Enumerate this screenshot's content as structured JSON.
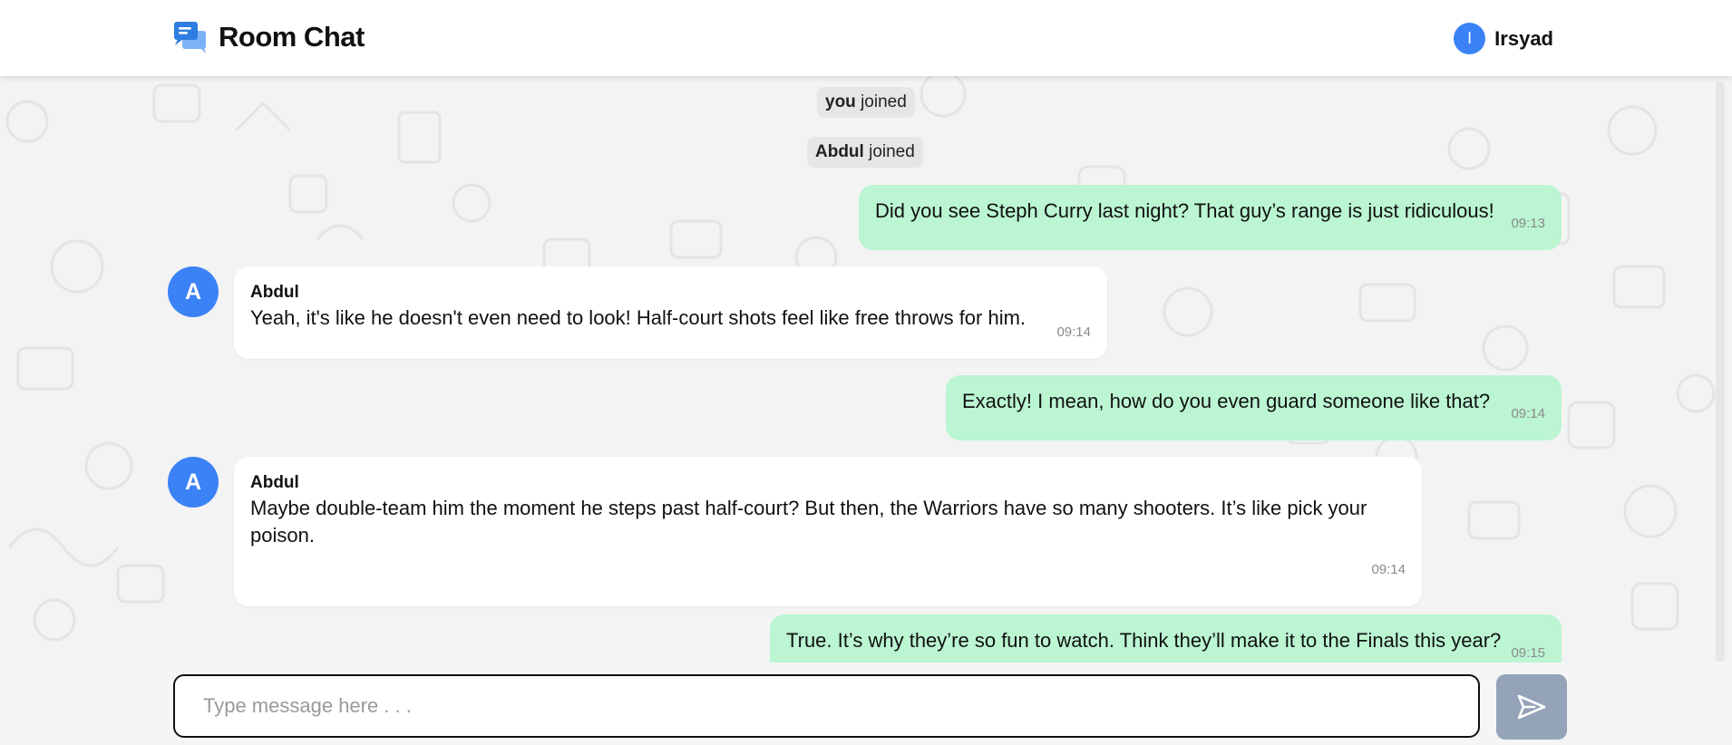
{
  "header": {
    "app_title": "Room Chat",
    "app_icon": "chat-bubbles-icon",
    "user": {
      "initial": "I",
      "name": "Irsyad"
    }
  },
  "system_messages": [
    {
      "name": "you",
      "text": "joined"
    },
    {
      "name": "Abdul",
      "text": "joined"
    }
  ],
  "messages": [
    {
      "from": "me",
      "text": "Did you see Steph Curry last night? That guy’s range is just ridiculous!",
      "time": "09:13"
    },
    {
      "from": "Abdul",
      "avatar": "A",
      "sender": "Abdul",
      "text": "Yeah, it's like he doesn't even need to look! Half-court shots feel like free throws for him.",
      "time": "09:14"
    },
    {
      "from": "me",
      "text": "Exactly! I mean, how do you even guard someone like that?",
      "time": "09:14"
    },
    {
      "from": "Abdul",
      "avatar": "A",
      "sender": "Abdul",
      "text": "Maybe double-team him the moment he steps past half-court? But then, the Warriors have so many shooters. It’s like pick your poison.",
      "time": "09:14"
    },
    {
      "from": "me",
      "text": "True. It’s why they’re so fun to watch. Think they’ll make it to the Finals this year?",
      "time": "09:15"
    }
  ],
  "composer": {
    "placeholder": "Type message here . . .",
    "value": "",
    "send_icon": "send-icon"
  },
  "colors": {
    "accent": "#3b82f6",
    "my_bubble": "#bbf5d2",
    "their_bubble": "#ffffff",
    "send_button": "#94a3b8"
  }
}
